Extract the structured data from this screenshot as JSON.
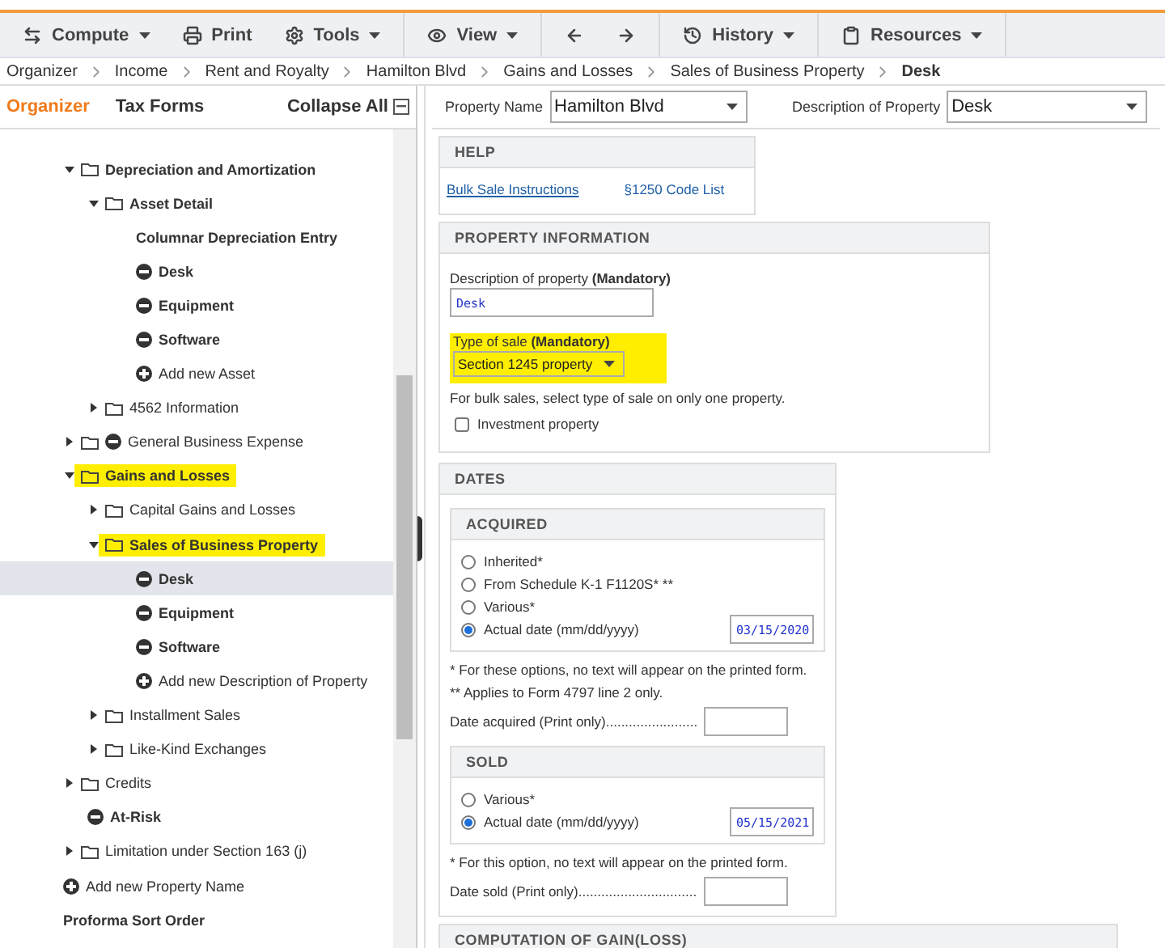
{
  "toolbar": [
    {
      "label": "Compute",
      "menu": true
    },
    {
      "label": "Print",
      "menu": false
    },
    {
      "label": "Tools",
      "menu": true
    },
    {
      "label": "View",
      "menu": true
    },
    {
      "label": "History",
      "menu": true
    },
    {
      "label": "Resources",
      "menu": true
    }
  ],
  "breadcrumb": [
    "Organizer",
    "Income",
    "Rent and Royalty",
    "Hamilton Blvd",
    "Gains and Losses",
    "Sales of Business Property",
    "Desk"
  ],
  "panel_tabs": [
    {
      "label": "Organizer",
      "selected": true
    },
    {
      "label": "Tax Forms",
      "selected": false
    }
  ],
  "collapse_all": "Collapse All",
  "tree": [
    {
      "kind": "folder",
      "label": "Depreciation and Amortization",
      "expanded": true,
      "highlighted": false,
      "children": [
        {
          "kind": "folder",
          "label": "Asset Detail",
          "expanded": true,
          "highlighted": false,
          "children": [
            {
              "kind": "plain",
              "label": "Columnar Depreciation Entry"
            },
            {
              "kind": "item",
              "label": "Desk",
              "selected": false
            },
            {
              "kind": "item",
              "label": "Equipment",
              "selected": false
            },
            {
              "kind": "item",
              "label": "Software",
              "selected": false
            },
            {
              "kind": "add",
              "label": "Add new Asset"
            }
          ]
        },
        {
          "kind": "folder",
          "label": "4562 Information",
          "expanded": false,
          "highlighted": false
        }
      ]
    },
    {
      "kind": "folder-item",
      "label": "General Business Expense",
      "expanded": false,
      "highlighted": false
    },
    {
      "kind": "folder",
      "label": "Gains and Losses",
      "expanded": true,
      "highlighted": true,
      "children": [
        {
          "kind": "folder",
          "label": "Capital Gains and Losses",
          "expanded": false,
          "highlighted": false
        },
        {
          "kind": "folder",
          "label": "Sales of Business Property",
          "expanded": true,
          "highlighted": true,
          "children": [
            {
              "kind": "item",
              "label": "Desk",
              "selected": true
            },
            {
              "kind": "item",
              "label": "Equipment",
              "selected": false
            },
            {
              "kind": "item",
              "label": "Software",
              "selected": false
            },
            {
              "kind": "add",
              "label": "Add new Description of Property"
            }
          ]
        },
        {
          "kind": "folder",
          "label": "Installment Sales",
          "expanded": false,
          "highlighted": false
        },
        {
          "kind": "folder",
          "label": "Like-Kind Exchanges",
          "expanded": false,
          "highlighted": false
        }
      ]
    },
    {
      "kind": "folder",
      "label": "Credits",
      "expanded": false,
      "highlighted": false
    },
    {
      "kind": "item",
      "label": "At-Risk",
      "selected": false
    },
    {
      "kind": "folder",
      "label": "Limitation under Section 163 (j)",
      "expanded": false,
      "highlighted": false
    }
  ],
  "tree_footer": [
    {
      "kind": "add",
      "label": "Add new Property Name"
    },
    {
      "kind": "plain",
      "label": "Proforma Sort Order"
    }
  ],
  "property_name": {
    "label": "Property Name",
    "value": "Hamilton Blvd"
  },
  "description_select": {
    "label": "Description of Property",
    "value": "Desk"
  },
  "help": {
    "title": "HELP",
    "links": [
      "Bulk Sale Instructions",
      "§1250 Code List"
    ]
  },
  "property_info": {
    "title": "PROPERTY INFORMATION",
    "description_label": "Description of property  **(Mandatory)**",
    "description_value": "Desk",
    "type_label": "Type of sale  **(Mandatory)**",
    "type_value": "Section 1245 property",
    "type_highlighted": true,
    "note": "For bulk sales, select type of sale on only one property.",
    "investment": {
      "label": "Investment property",
      "checked": false
    }
  },
  "dates": {
    "title": "DATES",
    "acquired": {
      "title": "ACQUIRED",
      "options": [
        {
          "label": "Inherited*",
          "selected": false
        },
        {
          "label": "From Schedule K-1 F1120S* **",
          "selected": false
        },
        {
          "label": "Various*",
          "selected": false
        },
        {
          "label": "Actual date (mm/dd/yyyy)",
          "selected": true,
          "date": "03/15/2020"
        }
      ]
    },
    "acquired_notes": [
      "* For these options, no text will appear on the printed form.",
      "** Applies to Form 4797 line 2 only."
    ],
    "acquired_print": "Date acquired (Print only)........................",
    "sold": {
      "title": "SOLD",
      "options": [
        {
          "label": "Various*",
          "selected": false
        },
        {
          "label": "Actual date (mm/dd/yyyy)",
          "selected": true,
          "date": "05/15/2021"
        }
      ]
    },
    "sold_notes": [
      "* For this option, no text will appear on the printed form."
    ],
    "sold_print": "Date sold (Print only)..............................."
  },
  "computation_title": "COMPUTATION OF GAIN(LOSS)"
}
